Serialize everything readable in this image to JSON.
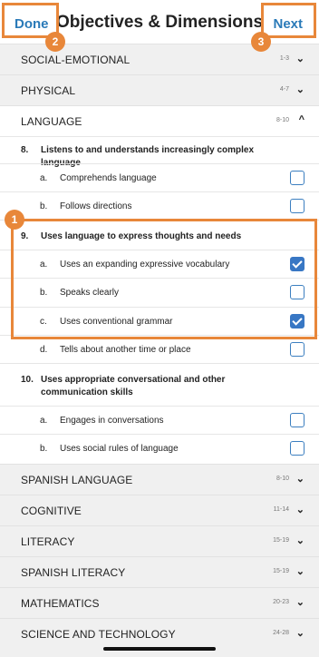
{
  "header": {
    "title": "Objectives & Dimensions",
    "done_label": "Done",
    "next_label": "Next"
  },
  "callouts": [
    "1",
    "2",
    "3"
  ],
  "sections_top": [
    {
      "label": "SOCIAL-EMOTIONAL",
      "range": "1-3",
      "chevron": "⌄"
    },
    {
      "label": "PHYSICAL",
      "range": "4-7",
      "chevron": "⌄"
    }
  ],
  "language": {
    "label": "LANGUAGE",
    "range": "8-10",
    "chevron": "^",
    "objectives": [
      {
        "num": "8.",
        "text": "Listens to and understands increasingly complex language",
        "dims": [
          {
            "letter": "a.",
            "text": "Comprehends language",
            "checked": false
          },
          {
            "letter": "b.",
            "text": "Follows directions",
            "checked": false
          }
        ]
      },
      {
        "num": "9.",
        "text": "Uses language to express thoughts and needs",
        "dims": [
          {
            "letter": "a.",
            "text": "Uses an expanding expressive vocabulary",
            "checked": true
          },
          {
            "letter": "b.",
            "text": "Speaks clearly",
            "checked": false
          },
          {
            "letter": "c.",
            "text": "Uses conventional grammar",
            "checked": true
          },
          {
            "letter": "d.",
            "text": "Tells about another time or place",
            "checked": false
          }
        ]
      },
      {
        "num": "10.",
        "text": "Uses appropriate conversational and other communication skills",
        "dims": [
          {
            "letter": "a.",
            "text": "Engages in conversations",
            "checked": false
          },
          {
            "letter": "b.",
            "text": "Uses social rules of language",
            "checked": false
          }
        ]
      }
    ]
  },
  "sections_bottom": [
    {
      "label": "SPANISH LANGUAGE",
      "range": "8-10",
      "chevron": "⌄"
    },
    {
      "label": "COGNITIVE",
      "range": "11-14",
      "chevron": "⌄"
    },
    {
      "label": "LITERACY",
      "range": "15-19",
      "chevron": "⌄"
    },
    {
      "label": "SPANISH LITERACY",
      "range": "15-19",
      "chevron": "⌄"
    },
    {
      "label": "MATHEMATICS",
      "range": "20-23",
      "chevron": "⌄"
    },
    {
      "label": "SCIENCE AND TECHNOLOGY",
      "range": "24-28",
      "chevron": "⌄"
    }
  ]
}
